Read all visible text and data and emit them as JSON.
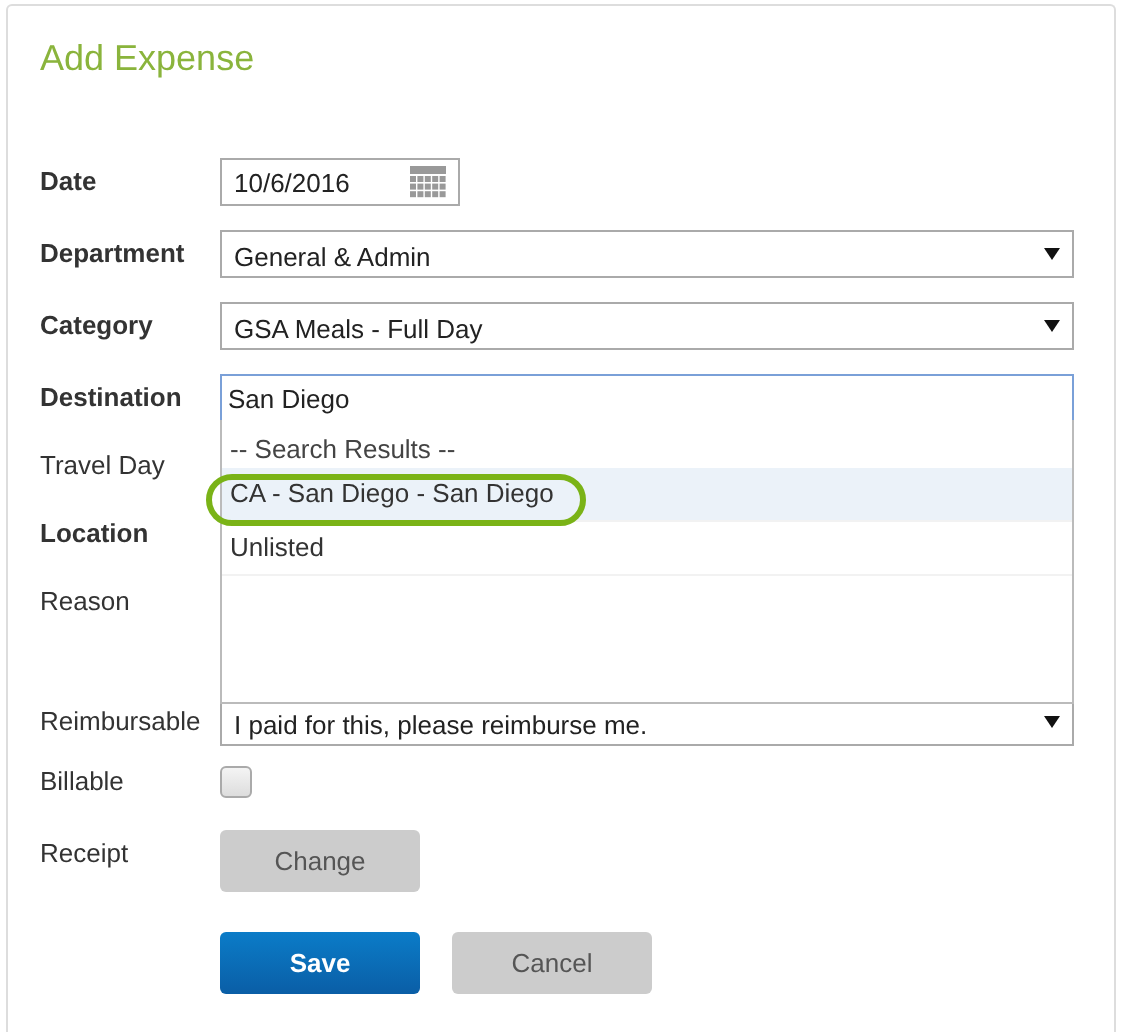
{
  "title": "Add Expense",
  "fields": [
    {
      "label": "Date",
      "bold": true,
      "kind": "date",
      "value": "10/6/2016"
    },
    {
      "label": "Department",
      "bold": true,
      "kind": "select",
      "value": "General & Admin"
    },
    {
      "label": "Category",
      "bold": true,
      "kind": "select",
      "value": "GSA Meals - Full Day"
    },
    {
      "label": "Destination",
      "bold": true,
      "kind": "search",
      "value": "San Diego",
      "focused": true,
      "results": {
        "header": "-- Search Results --",
        "items": [
          {
            "label": "CA - San Diego - San Diego",
            "selected": true,
            "circled": true
          },
          {
            "label": "Unlisted",
            "selected": false,
            "circled": false
          }
        ]
      }
    },
    {
      "label": "Travel Day",
      "bold": false,
      "kind": "covered"
    },
    {
      "label": "Location",
      "bold": true,
      "kind": "covered"
    },
    {
      "label": "Reason",
      "bold": false,
      "kind": "covered-tall"
    },
    {
      "label": "Reimbursable",
      "bold": false,
      "kind": "select",
      "value": "I paid for this, please reimburse me."
    },
    {
      "label": "Billable",
      "bold": false,
      "kind": "checkbox",
      "checked": false
    },
    {
      "label": "Receipt",
      "bold": false,
      "kind": "button",
      "value": "Change"
    }
  ],
  "buttons": [
    {
      "label": "Save",
      "primary": true
    },
    {
      "label": "Cancel",
      "primary": false
    }
  ]
}
